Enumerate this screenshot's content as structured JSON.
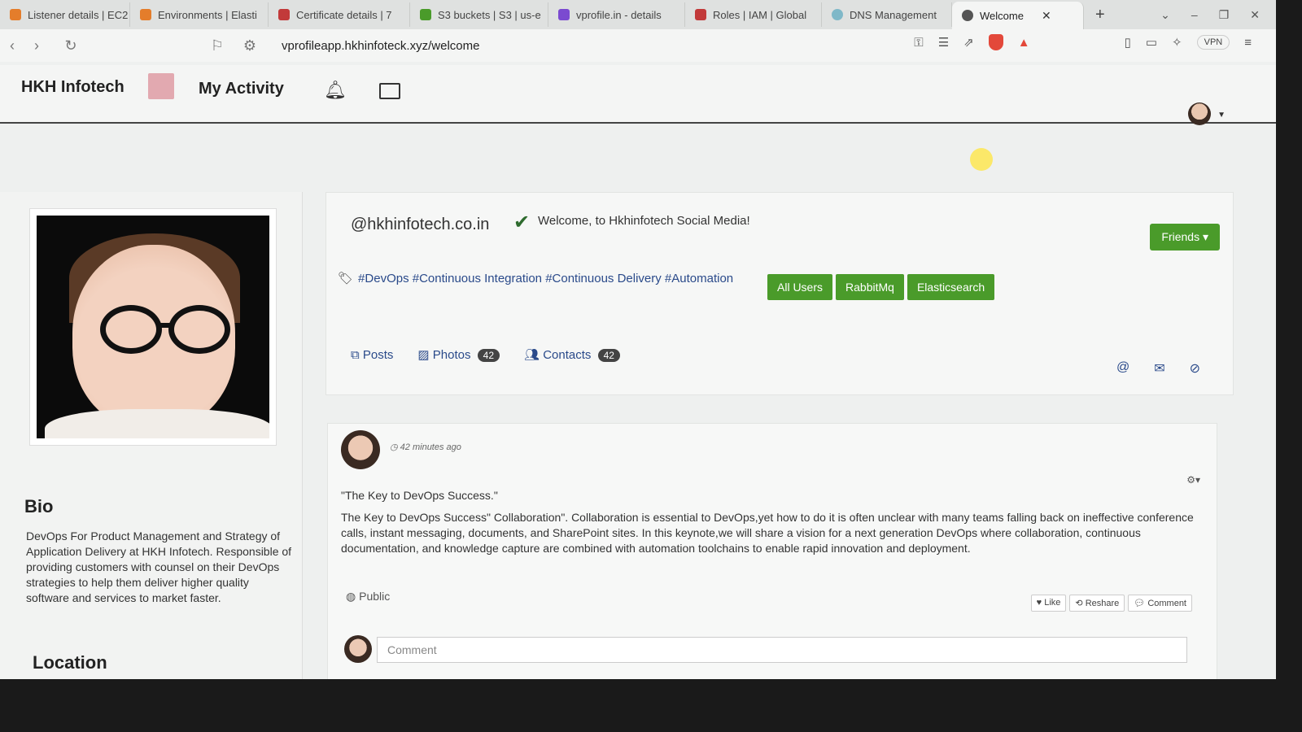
{
  "browser": {
    "tabs": [
      {
        "label": "Listener details | EC2",
        "color": "#e47d2b"
      },
      {
        "label": "Environments | Elasti",
        "color": "#e47d2b"
      },
      {
        "label": "Certificate details | 7",
        "color": "#c23a3a"
      },
      {
        "label": "S3 buckets | S3 | us-e",
        "color": "#4a9b2a"
      },
      {
        "label": "vprofile.in - details",
        "color": "#7b4ad0"
      },
      {
        "label": "Roles | IAM | Global",
        "color": "#c23a3a"
      },
      {
        "label": "DNS Management",
        "color": "#7fb8c8"
      },
      {
        "label": "Welcome",
        "color": "#555555",
        "active": true
      }
    ],
    "new_tab": "+",
    "url": "vprofileapp.hkhinfoteck.xyz/welcome",
    "vpn_label": "VPN"
  },
  "site": {
    "brand": "HKH Infotech",
    "nav_my_activity": "My Activity"
  },
  "profile": {
    "handle": "@hkhinfotech.co.in",
    "welcome": "Welcome, to Hkhinfotech Social Media!",
    "friends_btn": "Friends ▾",
    "hashtags": "#DevOps #Continuous Integration #Continuous Delivery #Automation",
    "buttons": [
      "All Users",
      "RabbitMq",
      "Elasticsearch"
    ],
    "nav": {
      "posts": "Posts",
      "photos": "Photos",
      "photos_count": "42",
      "contacts": "Contacts",
      "contacts_count": "42"
    }
  },
  "bio": {
    "heading": "Bio",
    "text": "DevOps For Product Management and Strategy of Application Delivery at HKH Infotech. Responsible of providing customers with counsel on their DevOps strategies to help them deliver higher quality software and services to market faster.",
    "location_heading": "Location"
  },
  "post": {
    "time": "42 minutes ago",
    "title": "\"The Key to DevOps Success.\"",
    "body": "The Key to DevOps Success\" Collaboration\". Collaboration is essential to DevOps,yet how to do it is often unclear with many teams falling back on ineffective conference calls, instant messaging, documents, and SharePoint sites. In this keynote,we will share a vision for a next generation DevOps where collaboration, continuous documentation, and knowledge capture are combined with automation toolchains to enable rapid innovation and deployment.",
    "visibility": "Public",
    "actions": [
      "Like",
      "Reshare",
      "Comment"
    ],
    "comment_placeholder": "Comment"
  }
}
